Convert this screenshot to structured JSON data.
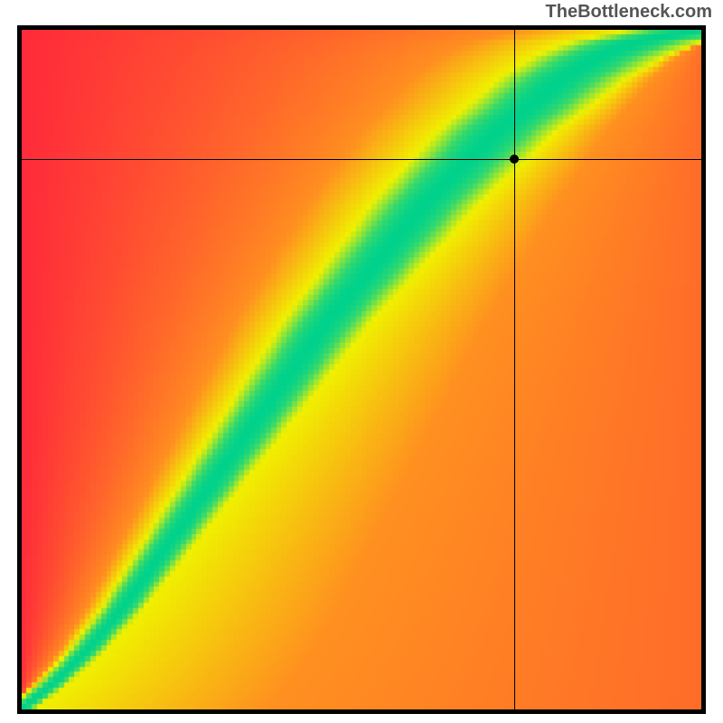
{
  "attribution": "TheBottleneck.com",
  "chart_data": {
    "type": "heatmap",
    "title": "",
    "xlabel": "",
    "ylabel": "",
    "xlim": [
      0,
      100
    ],
    "ylim": [
      0,
      100
    ],
    "grid_size": 128,
    "marker": {
      "x": 72.5,
      "y": 81.0
    },
    "crosshair": {
      "x": 72.5,
      "y": 81.0
    },
    "optimal_curve_points": [
      [
        0,
        0
      ],
      [
        5,
        4
      ],
      [
        10,
        9
      ],
      [
        15,
        15
      ],
      [
        20,
        22
      ],
      [
        25,
        29
      ],
      [
        30,
        36
      ],
      [
        35,
        43
      ],
      [
        40,
        50
      ],
      [
        45,
        57
      ],
      [
        50,
        63
      ],
      [
        55,
        69
      ],
      [
        60,
        75
      ],
      [
        65,
        80
      ],
      [
        70,
        85
      ],
      [
        75,
        89
      ],
      [
        80,
        93
      ],
      [
        85,
        96
      ],
      [
        90,
        98
      ],
      [
        95,
        99
      ],
      [
        100,
        100
      ]
    ],
    "colormap_description": "Red (worst) → Orange → Yellow → Green (best). A narrow green ridge marks optimal balance; color falls off to yellow/orange/red with distance from the ridge. Asymmetric: right side of ridge stays orange, left side fades to red.",
    "colors": {
      "best": "#00D28C",
      "good": "#F0F000",
      "mid": "#FF9020",
      "bad": "#FF2A3A"
    }
  }
}
